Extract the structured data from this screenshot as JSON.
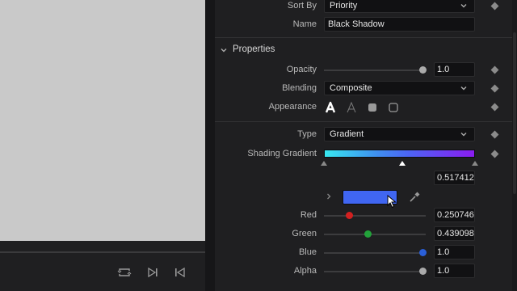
{
  "inspector": {
    "sort_by": {
      "label": "Sort By",
      "value": "Priority"
    },
    "name": {
      "label": "Name",
      "value": "Black Shadow"
    },
    "properties_section": {
      "title": "Properties"
    },
    "opacity": {
      "label": "Opacity",
      "value": "1.0",
      "fraction": 1.0
    },
    "blending": {
      "label": "Blending",
      "value": "Composite"
    },
    "appearance": {
      "label": "Appearance",
      "icons": [
        "solid-text-icon",
        "outline-text-icon",
        "filled-rounded-square-icon",
        "outline-rounded-square-icon"
      ]
    },
    "type": {
      "label": "Type",
      "value": "Gradient"
    },
    "shading_gradient": {
      "label": "Shading Gradient",
      "position_value": "0.517412",
      "stops": [
        0.0,
        0.517412,
        1.0
      ],
      "selected_stop": 1
    },
    "color": {
      "swatch_color": "#4066f2",
      "red": {
        "label": "Red",
        "value": "0.250746",
        "fraction": 0.250746,
        "color": "#d22020"
      },
      "green": {
        "label": "Green",
        "value": "0.439098",
        "fraction": 0.439098,
        "color": "#22a23a"
      },
      "blue": {
        "label": "Blue",
        "value": "1.0",
        "fraction": 1.0,
        "color": "#2a5fd8"
      },
      "alpha": {
        "label": "Alpha",
        "value": "1.0",
        "fraction": 1.0,
        "color": "#aaaaaa"
      }
    }
  },
  "colors": {
    "gradient_start": "#38e7ef",
    "gradient_end": "#8a1cf0",
    "viewer_bg": "#c9c9c9",
    "panel_bg": "#1f1f21"
  }
}
